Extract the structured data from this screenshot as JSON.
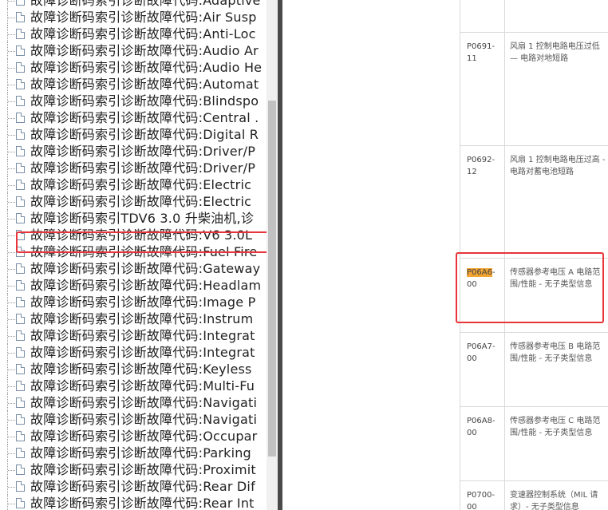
{
  "tree": {
    "items": [
      "故障诊断码索引诊断故障代码:Adaptive",
      "故障诊断码索引诊断故障代码:Air Susp",
      "故障诊断码索引诊断故障代码:Anti-Loc",
      "故障诊断码索引诊断故障代码:Audio Ar",
      "故障诊断码索引诊断故障代码:Audio He",
      "故障诊断码索引诊断故障代码:Automat",
      "故障诊断码索引诊断故障代码:Blindspo",
      "故障诊断码索引诊断故障代码:Central .",
      "故障诊断码索引诊断故障代码:Digital R",
      "故障诊断码索引诊断故障代码:Driver/P",
      "故障诊断码索引诊断故障代码:Driver/P",
      "故障诊断码索引诊断故障代码:Electric",
      "故障诊断码索引诊断故障代码:Electric",
      "故障诊断码索引TDV6 3.0 升柴油机,诊",
      "故障诊断码索引诊断故障代码:V6 3.0L",
      "故障诊断码索引诊断故障代码:Fuel Fire",
      "故障诊断码索引诊断故障代码:Gateway",
      "故障诊断码索引诊断故障代码:Headlam",
      "故障诊断码索引诊断故障代码:Image P",
      "故障诊断码索引诊断故障代码:Instrum",
      "故障诊断码索引诊断故障代码:Integrat",
      "故障诊断码索引诊断故障代码:Integrat",
      "故障诊断码索引诊断故障代码:Keyless",
      "故障诊断码索引诊断故障代码:Multi-Fu",
      "故障诊断码索引诊断故障代码:Navigati",
      "故障诊断码索引诊断故障代码:Navigati",
      "故障诊断码索引诊断故障代码:Occupar",
      "故障诊断码索引诊断故障代码:Parking",
      "故障诊断码索引诊断故障代码:Proximit",
      "故障诊断码索引诊断故障代码:Rear Dif",
      "故障诊断码索引诊断故障代码:Rear Int"
    ],
    "selected_index": 14
  },
  "dtc_table": {
    "rows": [
      {
        "code": "",
        "code_hl": "",
        "code_rest": "",
        "desc": ""
      },
      {
        "code": "P0691-11",
        "code_hl": "",
        "code_rest": "P0691-11",
        "desc": "风扇 1 控制电路电压过低 — 电路对地短路"
      },
      {
        "code": "P0692-12",
        "code_hl": "",
        "code_rest": "P0692-12",
        "desc": "风扇 1 控制电路电压过高 - 电路对蓄电池短路"
      },
      {
        "code": "P06A6-00",
        "code_hl": "P06A6",
        "code_rest": "-00",
        "desc": "传感器参考电压 A 电路范围/性能 - 无子类型信息"
      },
      {
        "code": "P06A7-00",
        "code_hl": "",
        "code_rest": "P06A7-00",
        "desc": "传感器参考电压 B 电路范围/性能 - 无子类型信息"
      },
      {
        "code": "P06A8-00",
        "code_hl": "",
        "code_rest": "P06A8-00",
        "desc": "传感器参考电压 C 电路范围/性能 - 无子类型信息"
      },
      {
        "code": "P0700-00",
        "code_hl": "",
        "code_rest": "P0700-00",
        "desc": "变速器控制系统（MIL 请求）- 无子类型信息"
      }
    ]
  }
}
